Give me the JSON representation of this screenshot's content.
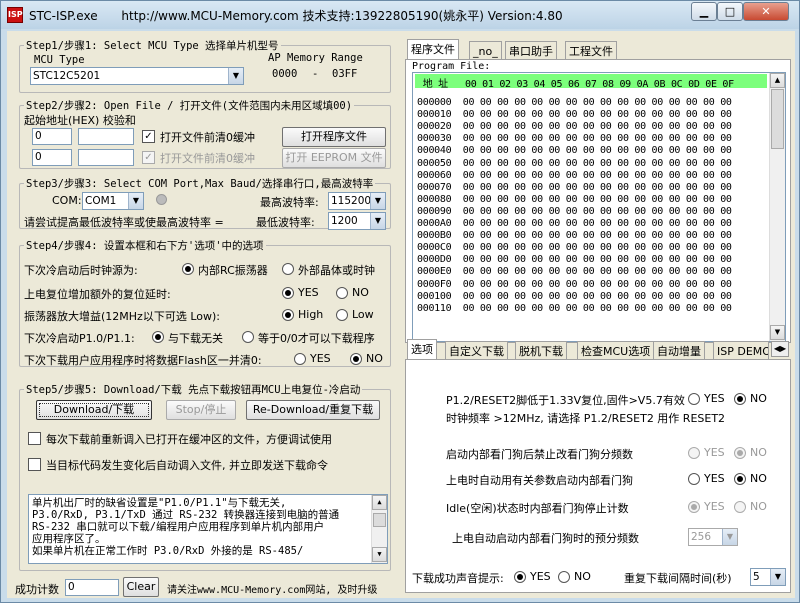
{
  "window": {
    "title": "STC-ISP.exe",
    "subtitle": "http://www.MCU-Memory.com 技术支持:13922805190(姚永平) Version:4.80",
    "min": "▁",
    "max": "□",
    "close": "✕"
  },
  "step1": {
    "legend": "Step1/步骤1: Select MCU Type  选择单片机型号",
    "mcu_type_label": "MCU Type",
    "mcu_value": "STC12C5201",
    "ap_label": "AP Memory Range",
    "ap_start": "0000",
    "ap_dash": "-",
    "ap_end": "03FF"
  },
  "step2": {
    "legend": "Step2/步骤2: Open File / 打开文件(文件范围内未用区域填00)",
    "addr_label": "起始地址(HEX) 校验和",
    "addr1": "0",
    "addr2": "0",
    "chk1_label": "打开文件前清0缓冲",
    "chk2_label": "打开文件前清0缓冲",
    "open_btn": "打开程序文件",
    "eeprom_btn": "打开 EEPROM 文件"
  },
  "step3": {
    "legend": "Step3/步骤3: Select COM Port,Max Baud/选择串行口,最高波特率",
    "com_label": "COM:",
    "com_value": "COM1",
    "max_label": "最高波特率:",
    "max_value": "115200",
    "hint": "请尝试提高最低波特率或使最高波特率 =",
    "min_label": "最低波特率:",
    "min_value": "1200"
  },
  "step4": {
    "legend": "Step4/步骤4: 设置本框和右下方'选项'中的选项",
    "r1_label": "下次冷启动后时钟源为:",
    "r1_a": "内部RC振荡器",
    "r1_b": "外部晶体或时钟",
    "r2_label": "上电复位增加额外的复位延时:",
    "r2_a": "YES",
    "r2_b": "NO",
    "r3_label": "振荡器放大增益(12MHz以下可选 Low):",
    "r3_a": "High",
    "r3_b": "Low",
    "r4_label": "下次冷启动P1.0/P1.1:",
    "r4_a": "与下载无关",
    "r4_b": "等于0/0才可以下载程序",
    "r5_label": "下次下载用户应用程序时将数据Flash区一并清0:",
    "r5_a": "YES",
    "r5_b": "NO"
  },
  "step5": {
    "legend": "Step5/步骤5: Download/下载  先点下载按钮再MCU上电复位-冷启动",
    "download_btn": "Download/下载",
    "stop_btn": "Stop/停止",
    "redownload_btn": "Re-Download/重复下载",
    "chk1_label": "每次下载前重新调入已打开在缓冲区的文件，方便调试使用",
    "chk2_label": "当目标代码发生变化后自动调入文件, 并立即发送下载命令",
    "note1": "    单片机出厂时的缺省设置是\"P1.0/P1.1\"与下载无关,",
    "note2": "P3.0/RxD, P3.1/TxD 通过 RS-232 转换器连接到电脑的普通",
    "note3": "RS-232 串口就可以下载/编程用户应用程序到单片机内部用户",
    "note4": "应用程序区了。",
    "note5": "    如果单片机在正常工作时 P3.0/RxD 外接的是 RS-485/"
  },
  "status": {
    "count_label": "成功计数",
    "count_value": "0",
    "clear_btn": "Clear",
    "footer": "请关注www.MCU-Memory.com网站, 及时升级"
  },
  "right_tabs": [
    {
      "label": "程序文件"
    },
    {
      "label": "_no_"
    },
    {
      "label": "串口助手"
    },
    {
      "label": "工程文件"
    }
  ],
  "program": {
    "label": "Program File:",
    "header": " 地 址   00 01 02 03 04 05 06 07 08 09 0A 0B 0C 0D 0E 0F",
    "rows": [
      "000000  00 00 00 00 00 00 00 00 00 00 00 00 00 00 00 00",
      "000010  00 00 00 00 00 00 00 00 00 00 00 00 00 00 00 00",
      "000020  00 00 00 00 00 00 00 00 00 00 00 00 00 00 00 00",
      "000030  00 00 00 00 00 00 00 00 00 00 00 00 00 00 00 00",
      "000040  00 00 00 00 00 00 00 00 00 00 00 00 00 00 00 00",
      "000050  00 00 00 00 00 00 00 00 00 00 00 00 00 00 00 00",
      "000060  00 00 00 00 00 00 00 00 00 00 00 00 00 00 00 00",
      "000070  00 00 00 00 00 00 00 00 00 00 00 00 00 00 00 00",
      "000080  00 00 00 00 00 00 00 00 00 00 00 00 00 00 00 00",
      "000090  00 00 00 00 00 00 00 00 00 00 00 00 00 00 00 00",
      "0000A0  00 00 00 00 00 00 00 00 00 00 00 00 00 00 00 00",
      "0000B0  00 00 00 00 00 00 00 00 00 00 00 00 00 00 00 00",
      "0000C0  00 00 00 00 00 00 00 00 00 00 00 00 00 00 00 00",
      "0000D0  00 00 00 00 00 00 00 00 00 00 00 00 00 00 00 00",
      "0000E0  00 00 00 00 00 00 00 00 00 00 00 00 00 00 00 00",
      "0000F0  00 00 00 00 00 00 00 00 00 00 00 00 00 00 00 00",
      "000100  00 00 00 00 00 00 00 00 00 00 00 00 00 00 00 00",
      "000110  00 00 00 00 00 00 00 00 00 00 00 00 00 00 00 00"
    ]
  },
  "option_tabs": [
    {
      "label": "选项"
    },
    {
      "label": "自定义下载"
    },
    {
      "label": "脱机下载"
    },
    {
      "label": "检查MCU选项"
    },
    {
      "label": "自动增量"
    },
    {
      "label": "ISP DEMO"
    }
  ],
  "options": {
    "o1_label": "P1.2/RESET2脚低于1.33V复位,固件>V5.7有效",
    "o1_a": "YES",
    "o1_b": "NO",
    "o1_sub": "时钟频率 >12MHz, 请选择 P1.2/RESET2 用作 RESET2",
    "o2_label": "启动内部看门狗后禁止改看门狗分频数",
    "o2_a": "YES",
    "o2_b": "NO",
    "o3_label": "上电时自动用有关参数启动内部看门狗",
    "o3_a": "YES",
    "o3_b": "NO",
    "o4_label": "Idle(空闲)状态时内部看门狗停止计数",
    "o4_a": "YES",
    "o4_b": "NO",
    "o5_label": "上电自动启动内部看门狗时的预分频数",
    "o5_value": "256",
    "sound_label": "下载成功声音提示:",
    "sound_a": "YES",
    "sound_b": "NO",
    "interval_label": "重复下载间隔时间(秒)",
    "interval_value": "5"
  }
}
